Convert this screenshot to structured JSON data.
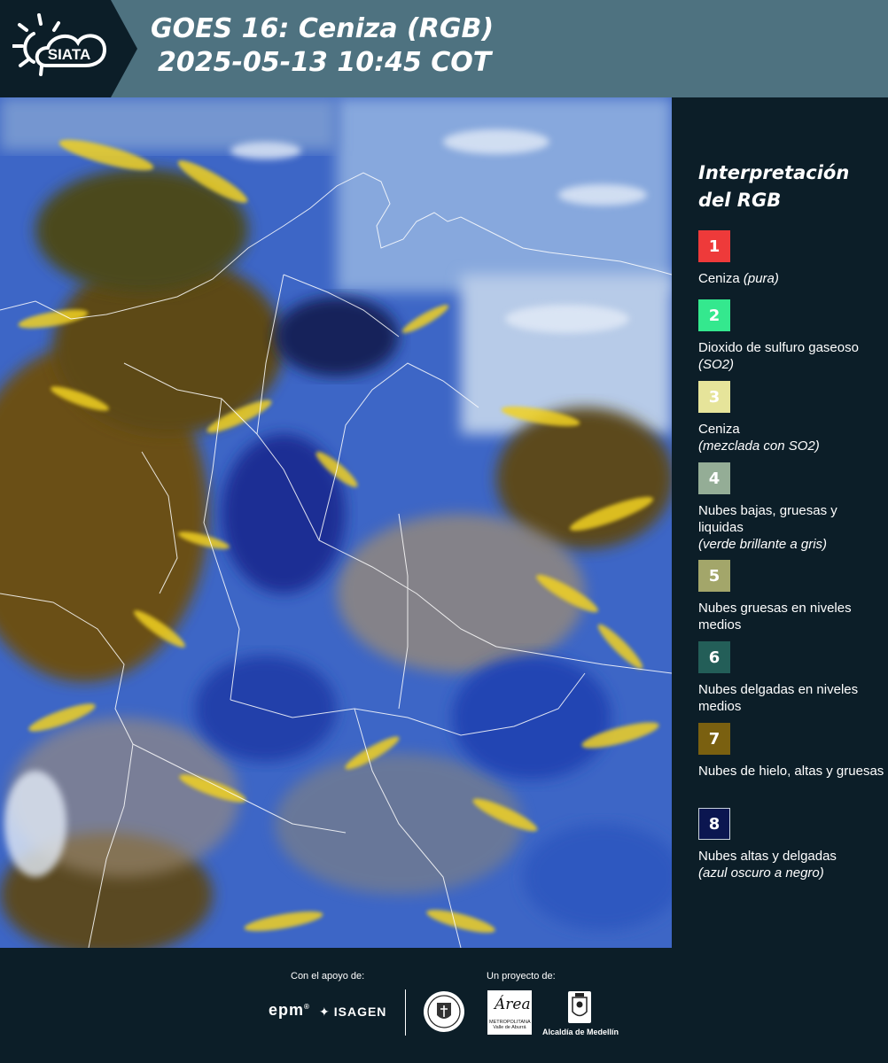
{
  "header": {
    "logo_text": "SIATA",
    "title_line1": "GOES 16: Ceniza (RGB)",
    "title_line2": "2025-05-13 10:45 COT"
  },
  "legend": {
    "title": "Interpretación del RGB",
    "items": [
      {
        "number": "1",
        "color": "#ee3a3a",
        "label": "Ceniza",
        "note": "(pura)"
      },
      {
        "number": "2",
        "color": "#34e88e",
        "label": "Dioxido de sulfuro gaseoso",
        "note": "(SO2)"
      },
      {
        "number": "3",
        "color": "#e6e49a",
        "label": "Ceniza",
        "note": "(mezclada con SO2)"
      },
      {
        "number": "4",
        "color": "#94ad96",
        "label": "Nubes bajas, gruesas y liquidas",
        "note": "(verde brillante a gris)"
      },
      {
        "number": "5",
        "color": "#a3a66a",
        "label": "Nubes gruesas en niveles medios",
        "note": ""
      },
      {
        "number": "6",
        "color": "#235e58",
        "label": "Nubes delgadas en niveles medios",
        "note": ""
      },
      {
        "number": "7",
        "color": "#7a6010",
        "label": "Nubes de hielo, altas y gruesas",
        "note": ""
      },
      {
        "number": "8",
        "color": "#0b1650",
        "label": "Nubes altas y delgadas",
        "note": "(azul oscuro a negro)"
      }
    ]
  },
  "footer": {
    "support_label": "Con el apoyo de:",
    "project_label": "Un proyecto de:",
    "sponsor_epm": "epm",
    "sponsor_isagen": "ISAGEN",
    "area_logo_text": "Área",
    "area_logo_sub": "METROPOLITANA Valle de Aburrá",
    "medellin_label": "Alcaldía de Medellín"
  }
}
